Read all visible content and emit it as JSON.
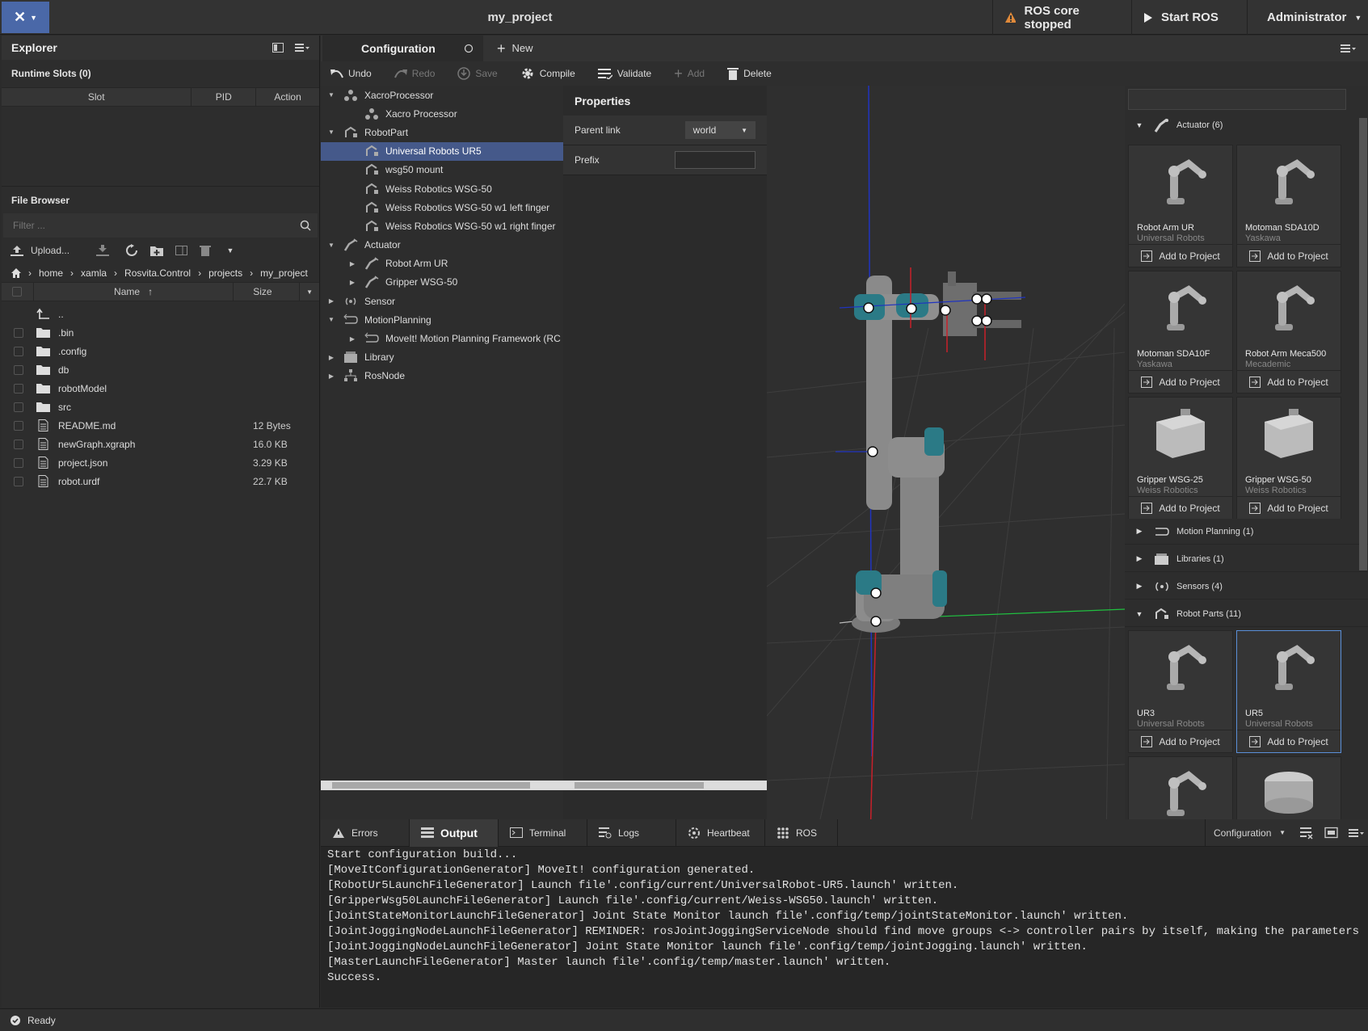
{
  "titlebar": {
    "project": "my_project",
    "ros_status": "ROS core stopped",
    "start_ros": "Start ROS",
    "user": "Administrator"
  },
  "explorer": {
    "title": "Explorer",
    "runtime_slots": "Runtime Slots (0)",
    "slot_cols": [
      "Slot",
      "PID",
      "Action"
    ],
    "file_browser": "File Browser",
    "filter_placeholder": "Filter ...",
    "upload": "Upload...",
    "breadcrumb": [
      "home",
      "xamla",
      "Rosvita.Control",
      "projects",
      "my_project"
    ],
    "cols": {
      "name": "Name",
      "size": "Size"
    },
    "files": [
      {
        "name": "..",
        "size": "",
        "type": "up"
      },
      {
        "name": ".bin",
        "size": "",
        "type": "folder"
      },
      {
        "name": ".config",
        "size": "",
        "type": "folder"
      },
      {
        "name": "db",
        "size": "",
        "type": "folder"
      },
      {
        "name": "robotModel",
        "size": "",
        "type": "folder"
      },
      {
        "name": "src",
        "size": "",
        "type": "folder"
      },
      {
        "name": "README.md",
        "size": "12 Bytes",
        "type": "file"
      },
      {
        "name": "newGraph.xgraph",
        "size": "16.0 KB",
        "type": "file"
      },
      {
        "name": "project.json",
        "size": "3.29 KB",
        "type": "file"
      },
      {
        "name": "robot.urdf",
        "size": "22.7 KB",
        "type": "file"
      }
    ]
  },
  "config": {
    "tab": "Configuration",
    "new_tab": "New",
    "toolbar": {
      "undo": "Undo",
      "redo": "Redo",
      "save": "Save",
      "compile": "Compile",
      "validate": "Validate",
      "add": "Add",
      "delete": "Delete"
    },
    "tree": [
      {
        "label": "XacroProcessor",
        "level": 0,
        "arrow": "▼"
      },
      {
        "label": "Xacro Processor",
        "level": 1,
        "arrow": ""
      },
      {
        "label": "RobotPart",
        "level": 0,
        "arrow": "▼"
      },
      {
        "label": "Universal Robots UR5",
        "level": 1,
        "arrow": "",
        "selected": true
      },
      {
        "label": "wsg50 mount",
        "level": 1,
        "arrow": ""
      },
      {
        "label": "Weiss Robotics WSG-50",
        "level": 1,
        "arrow": ""
      },
      {
        "label": "Weiss Robotics WSG-50 w1 left finger",
        "level": 1,
        "arrow": ""
      },
      {
        "label": "Weiss Robotics WSG-50 w1 right finger",
        "level": 1,
        "arrow": ""
      },
      {
        "label": "Actuator",
        "level": 0,
        "arrow": "▼"
      },
      {
        "label": "Robot Arm UR",
        "level": 1,
        "arrow": "▶"
      },
      {
        "label": "Gripper WSG-50",
        "level": 1,
        "arrow": "▶"
      },
      {
        "label": "Sensor",
        "level": 0,
        "arrow": "▶"
      },
      {
        "label": "MotionPlanning",
        "level": 0,
        "arrow": "▼"
      },
      {
        "label": "MoveIt! Motion Planning Framework (RC",
        "level": 1,
        "arrow": "▶"
      },
      {
        "label": "Library",
        "level": 0,
        "arrow": "▶"
      },
      {
        "label": "RosNode",
        "level": 0,
        "arrow": "▶"
      }
    ],
    "properties": {
      "title": "Properties",
      "parent_link_label": "Parent link",
      "parent_link_value": "world",
      "prefix_label": "Prefix",
      "prefix_value": ""
    }
  },
  "library": {
    "add_label": "Add to Project",
    "actuator_cat": "Actuator (6)",
    "cards": [
      {
        "title": "Robot Arm UR",
        "sub": "Universal Robots"
      },
      {
        "title": "Motoman SDA10D",
        "sub": "Yaskawa"
      },
      {
        "title": "Motoman SDA10F",
        "sub": "Yaskawa"
      },
      {
        "title": "Robot Arm Meca500",
        "sub": "Mecademic"
      },
      {
        "title": "Gripper WSG-25",
        "sub": "Weiss Robotics"
      },
      {
        "title": "Gripper WSG-50",
        "sub": "Weiss Robotics"
      }
    ],
    "categories": [
      "Motion Planning (1)",
      "Libraries (1)",
      "Sensors (4)",
      "Robot Parts (11)"
    ],
    "part_cards": [
      {
        "title": "UR3",
        "sub": "Universal Robots"
      },
      {
        "title": "UR5",
        "sub": "Universal Robots"
      }
    ]
  },
  "output": {
    "tabs": [
      "Errors",
      "Output",
      "Terminal",
      "Logs",
      "Heartbeat",
      "ROS"
    ],
    "filter": "Configuration",
    "lines": [
      "Start configuration build...",
      "[MoveItConfigurationGenerator] MoveIt! configuration generated.",
      "[RobotUr5LaunchFileGenerator] Launch file'.config/current/UniversalRobot-UR5.launch' written.",
      "[GripperWsg50LaunchFileGenerator] Launch file'.config/current/Weiss-WSG50.launch' written.",
      "[JointStateMonitorLaunchFileGenerator] Joint State Monitor launch file'.config/temp/jointStateMonitor.launch' written.",
      "[JointJoggingNodeLaunchFileGenerator] REMINDER: rosJointJoggingServiceNode should find move groups <-> controller pairs by itself, making the parameters",
      "[JointJoggingNodeLaunchFileGenerator] Joint State Monitor launch file'.config/temp/jointJogging.launch' written.",
      "[MasterLaunchFileGenerator] Master launch file'.config/temp/master.launch' written.",
      "Success."
    ]
  },
  "status": {
    "text": "Ready"
  }
}
